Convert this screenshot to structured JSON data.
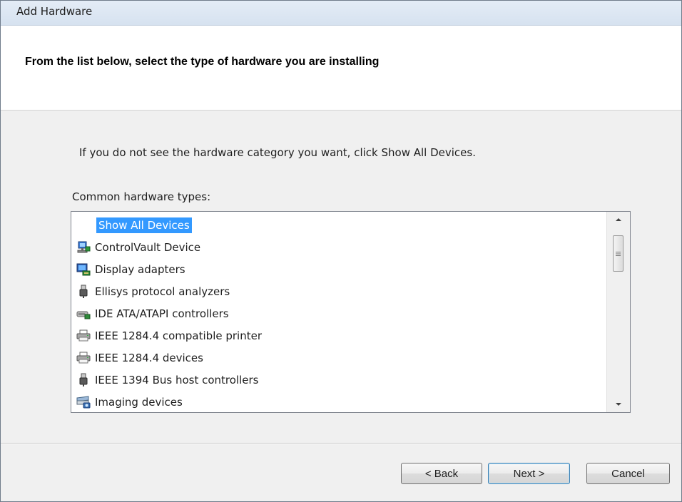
{
  "window": {
    "title": "Add Hardware"
  },
  "header": {
    "heading": "From the list below, select the type of hardware you are installing"
  },
  "content": {
    "instruction": "If you do not see the hardware category you want, click Show All Devices.",
    "list_label": "Common hardware types:"
  },
  "hardware_list": {
    "items": [
      {
        "label": "Show All Devices",
        "icon": "none",
        "selected": true
      },
      {
        "label": "ControlVault Device",
        "icon": "network-computer-icon"
      },
      {
        "label": "Display adapters",
        "icon": "display-adapter-icon"
      },
      {
        "label": "Ellisys protocol analyzers",
        "icon": "usb-plug-icon"
      },
      {
        "label": "IDE ATA/ATAPI controllers",
        "icon": "ide-controller-icon"
      },
      {
        "label": "IEEE 1284.4 compatible printer",
        "icon": "printer-icon"
      },
      {
        "label": "IEEE 1284.4 devices",
        "icon": "printer-icon"
      },
      {
        "label": "IEEE 1394 Bus host controllers",
        "icon": "usb-plug-icon"
      },
      {
        "label": "Imaging devices",
        "icon": "scanner-camera-icon"
      }
    ]
  },
  "buttons": {
    "back": "< Back",
    "next": "Next >",
    "cancel": "Cancel"
  },
  "colors": {
    "selection": "#3399ff",
    "dialog_bg": "#f0f0f0",
    "header_bg": "#ffffff"
  }
}
